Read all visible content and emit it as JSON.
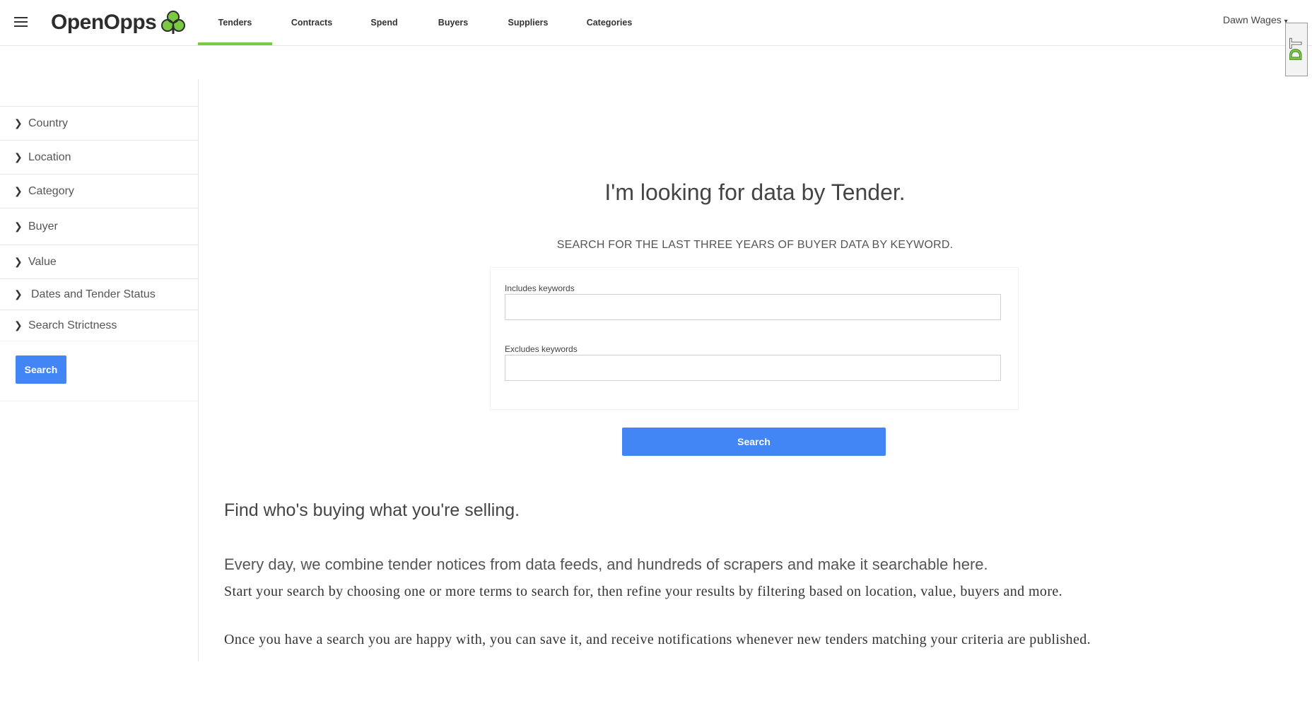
{
  "header": {
    "logo_text": "OpenOpps",
    "user_name": "Dawn Wages",
    "nav": [
      {
        "label": "Tenders",
        "active": true
      },
      {
        "label": "Contracts",
        "active": false
      },
      {
        "label": "Spend",
        "active": false
      },
      {
        "label": "Buyers",
        "active": false
      },
      {
        "label": "Suppliers",
        "active": false
      },
      {
        "label": "Categories",
        "active": false
      }
    ],
    "badge_text": "DT"
  },
  "sidebar": {
    "filters": [
      {
        "label": "Country"
      },
      {
        "label": "Location"
      },
      {
        "label": "Category"
      },
      {
        "label": "Buyer"
      },
      {
        "label": "Value"
      },
      {
        "label": "Dates and Tender Status"
      },
      {
        "label": "Search Strictness"
      }
    ],
    "search_label": "Search"
  },
  "main": {
    "title": "I'm looking for data by Tender.",
    "subtitle": "SEARCH FOR THE LAST THREE YEARS OF BUYER DATA BY KEYWORD.",
    "includes_label": "Includes keywords",
    "includes_value": "",
    "excludes_label": "Excludes keywords",
    "excludes_value": "",
    "search_label": "Search"
  },
  "intro": {
    "heading": "Find who's buying what you're selling.",
    "p1": "Every day, we combine tender notices from data feeds, and hundreds of scrapers and make it searchable here.",
    "p2": "Start your search by choosing one or more terms to search for, then refine your results by filtering based on location, value, buyers and more.",
    "p3": "Once you have a search you are happy with, you can save it, and receive notifications whenever new tenders matching your criteria are published."
  },
  "colors": {
    "accent_green": "#7ac943",
    "button_blue": "#4285f4"
  }
}
